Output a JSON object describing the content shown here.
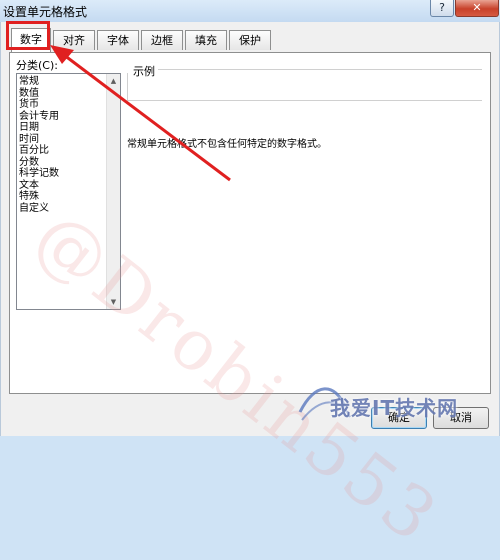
{
  "window": {
    "title": "设置单元格格式",
    "help_glyph": "?",
    "close_glyph": "✕"
  },
  "tabs": [
    {
      "label": "数字",
      "active": true
    },
    {
      "label": "对齐",
      "active": false
    },
    {
      "label": "字体",
      "active": false
    },
    {
      "label": "边框",
      "active": false
    },
    {
      "label": "填充",
      "active": false
    },
    {
      "label": "保护",
      "active": false
    }
  ],
  "category": {
    "label": "分类(C):",
    "items": [
      "常规",
      "数值",
      "货币",
      "会计专用",
      "日期",
      "时间",
      "百分比",
      "分数",
      "科学记数",
      "文本",
      "特殊",
      "自定义"
    ],
    "selected": "常规"
  },
  "sample": {
    "title": "示例"
  },
  "description": "常规单元格格式不包含任何特定的数字格式。",
  "buttons": {
    "ok": "确定",
    "cancel": "取消"
  },
  "watermark": "@Drobin553",
  "brand": {
    "text": "我爱IT技术网"
  },
  "colors": {
    "annotation": "#e02020",
    "accent": "#3c7fb1"
  }
}
